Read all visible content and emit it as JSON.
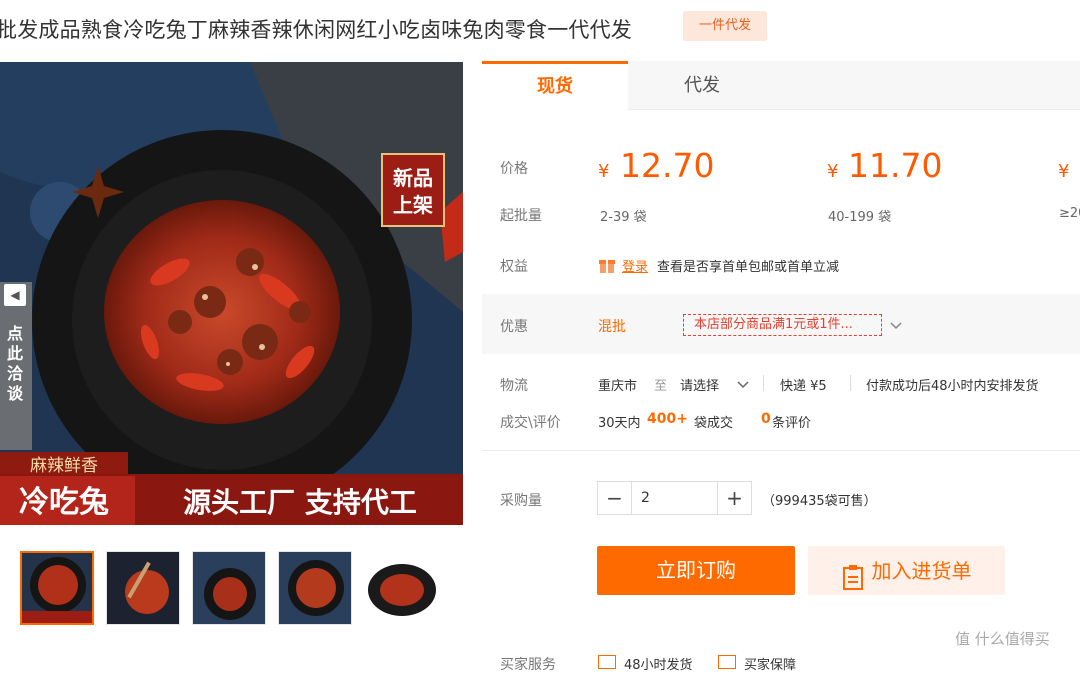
{
  "title": "批发成品熟食冷吃兔丁麻辣香辣休闲网红小吃卤味兔肉零食一代代发",
  "badge": "一件代发",
  "main_image": {
    "corner_badge_line1": "新品",
    "corner_badge_line2": "上架",
    "banner_top": "麻辣鲜香",
    "banner_left": "冷吃兔",
    "banner_right": "源头工厂 支持代工"
  },
  "side_tab": {
    "arrow": "◀",
    "text": "点此洽谈"
  },
  "tabs": [
    {
      "label": "现货"
    },
    {
      "label": "代发"
    }
  ],
  "price": {
    "label": "价格",
    "currency": "¥",
    "tiers": [
      {
        "price": "12.70",
        "qty": "2-39 袋"
      },
      {
        "price": "11.70",
        "qty": "40-199 袋"
      },
      {
        "price": "",
        "qty": "≥20"
      }
    ],
    "qty_label": "起批量"
  },
  "benefit": {
    "label": "权益",
    "login": "登录",
    "text": "查看是否享首单包邮或首单立减"
  },
  "promo": {
    "label": "优惠",
    "type": "混批",
    "tag": "本店部分商品满1元或1件..."
  },
  "logistics": {
    "label": "物流",
    "from": "重庆市",
    "to_word": "至",
    "select": "请选择",
    "express": "快递 ¥5",
    "ship": "付款成功后48小时内安排发货"
  },
  "deals": {
    "label": "成交\\评价",
    "prefix": "30天内",
    "count": "400+",
    "unit": "袋成交",
    "reviews": "0",
    "reviews_unit": "条评价"
  },
  "purchase": {
    "label": "采购量",
    "minus": "−",
    "value": "2",
    "plus": "+",
    "stock": "（999435袋可售）"
  },
  "buttons": {
    "buy": "立即订购",
    "cart": "加入进货单"
  },
  "bottom_partial": {
    "label": "买家服务",
    "item1": "48小时发货",
    "item2": "买家保障"
  },
  "watermark": "值 什么值得买",
  "colors": {
    "accent": "#ff6a00",
    "promo": "#e3402f"
  }
}
